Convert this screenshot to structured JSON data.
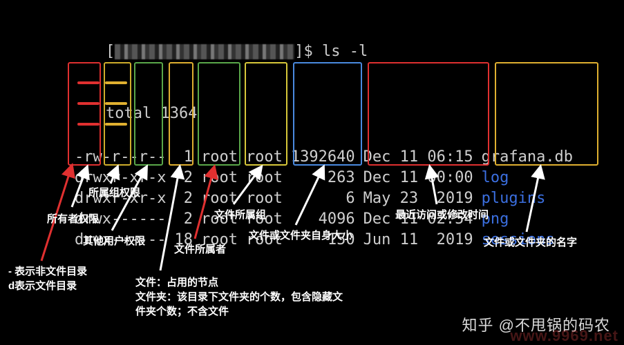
{
  "prompt": {
    "bracket_open": "[",
    "bracket_close": "]",
    "suffix": "$ ",
    "command": "ls -l"
  },
  "total": {
    "label": "total",
    "value": "1364"
  },
  "rows": [
    {
      "perm": "-rw-r--r--",
      "links": "1",
      "owner": "root",
      "group": "root",
      "size": "1392640",
      "date": "Dec 11 06:15",
      "name": "grafana.db",
      "dir": false
    },
    {
      "perm": "drwxr-xr-x",
      "links": "2",
      "owner": "root",
      "group": "root",
      "size": "263",
      "date": "Dec 11 00:00",
      "name": "log",
      "dir": true
    },
    {
      "perm": "drwxr-xr-x",
      "links": "2",
      "owner": "root",
      "group": "root",
      "size": "6",
      "date": "May 23  2019",
      "name": "plugins",
      "dir": true
    },
    {
      "perm": "drwx------",
      "links": "2",
      "owner": "root",
      "group": "root",
      "size": "4096",
      "date": "Dec 11 02:54",
      "name": "png",
      "dir": true
    },
    {
      "perm": "drwx------",
      "links": "18",
      "owner": "root",
      "group": "root",
      "size": "150",
      "date": "Jun 11  2019",
      "name": "sessions",
      "dir": true
    }
  ],
  "labels": {
    "type": "- 表示非文件目录\nd表示文件目录",
    "owner_perm": "所有者权限",
    "group_perm": "所属组权限",
    "other_perm": "其他用户权限",
    "links": "文件：占用的节点\n文件夹：该目录下文件夹的个数，包含隐藏文\n件夹个数；不含文件",
    "owner": "文件所属者",
    "group": "文件所属组",
    "size": "文件或文件夹自身大小",
    "date": "最近访问或修改时间",
    "name": "文件或文件夹的名字"
  },
  "watermark": "知乎 @不甩锅的码农",
  "siteurl": "www.9969.net"
}
